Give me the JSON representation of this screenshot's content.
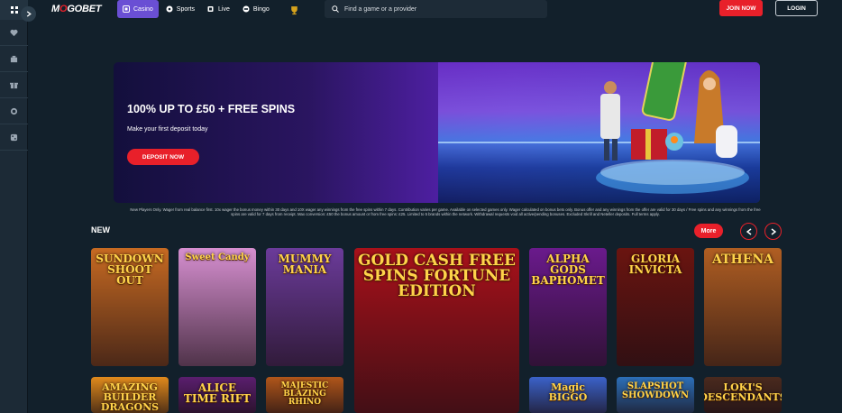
{
  "sidebar": {
    "icons": [
      "grid-icon",
      "heart-icon",
      "building-icon",
      "gift-icon",
      "coin-icon",
      "dice-icon"
    ]
  },
  "header": {
    "logo": {
      "prefix": "M",
      "o": "O",
      "suffix": "GOBET"
    },
    "tabs": [
      {
        "label": "Casino",
        "active": true
      },
      {
        "label": "Sports"
      },
      {
        "label": "Live"
      },
      {
        "label": "Bingo"
      }
    ],
    "search_placeholder": "Find a game or a provider",
    "join_label": "JOIN NOW",
    "login_label": "LOGIN"
  },
  "hero": {
    "headline": "100% UP TO £50 + FREE SPINS",
    "subtitle": "Make your first deposit today",
    "cta": "DEPOSIT NOW"
  },
  "disclaimer": "New Players Only. Wager from real balance first. 10x wager the bonus money within 30 days and 10X wager any winnings from the free spins within 7 days. Contribution varies per game. Available on selected games only. Wager calculated on bonus bets only. Bonus offer and any winnings from the offer are valid for 30 days / Free spins and any winnings from the free spins are valid for 7 days from receipt. Max conversion: £50 the bonus amount or from free spins: £25. Limited to 5 brands within the network. Withdrawal requests void all active/pending bonuses. Excluded Skrill and Neteller deposits. Full terms apply.",
  "section": {
    "title": "NEW",
    "more_label": "More"
  },
  "games": [
    {
      "name": "SUNDOWN SHOOT OUT",
      "bg": "#c76a22"
    },
    {
      "name": "Sweet Candy",
      "bg": "#d68fd0"
    },
    {
      "name": "MUMMY MANIA",
      "bg": "#6b3b9a"
    },
    {
      "name": "GOLD CASH FREE SPINS FORTUNE EDITION",
      "bg": "#a8111a"
    },
    {
      "name": "ALPHA GODS BAPHOMET",
      "bg": "#6a1a8c"
    },
    {
      "name": "GLORIA INVICTA",
      "bg": "#6a1410"
    },
    {
      "name": "ATHENA",
      "bg": "#b05e22"
    },
    {
      "name": "AMAZING BUILDER DRAGONS",
      "bg": "#e08a1c"
    },
    {
      "name": "ALICE TIME RIFT",
      "bg": "#5a1e6e"
    },
    {
      "name": "MAJESTIC BLAZING RHINO",
      "bg": "#b0561a"
    },
    {
      "name": "Magic BIGGO",
      "bg": "#3b62c9"
    },
    {
      "name": "SLAPSHOT SHOWDOWN",
      "bg": "#2c6fb8"
    },
    {
      "name": "LOKI'S DESCENDANTS",
      "bg": "#4a2a1e"
    }
  ]
}
